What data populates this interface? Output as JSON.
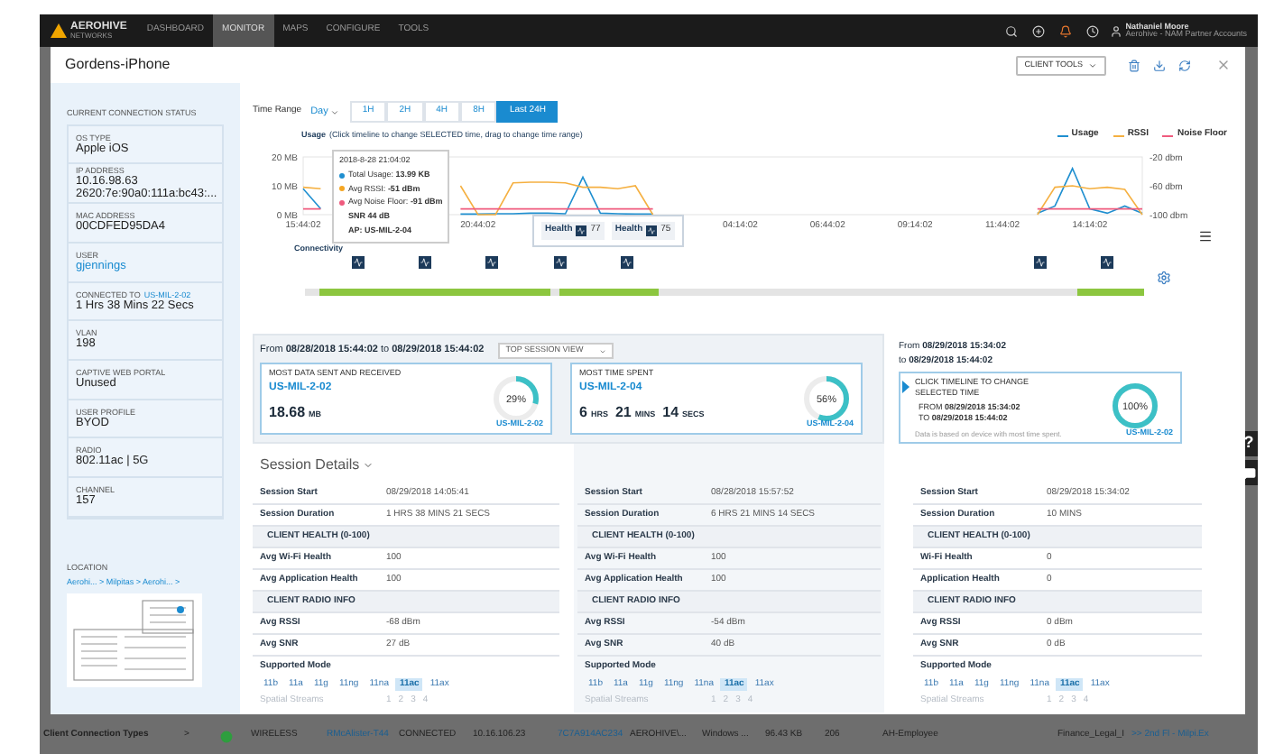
{
  "nav": {
    "logo": "AEROHIVE",
    "logo_sub": "NETWORKS",
    "items": [
      {
        "label": "DASHBOARD",
        "selected": false
      },
      {
        "label": "MONITOR",
        "selected": true
      },
      {
        "label": "MAPS",
        "selected": false
      },
      {
        "label": "CONFIGURE",
        "selected": false
      },
      {
        "label": "TOOLS",
        "selected": false
      }
    ],
    "user_name": "Nathaniel Moore",
    "user_account": "Aerohive - NAM Partner Accounts"
  },
  "page": {
    "side_label": "Client Connection Types",
    "side_chevron": ">",
    "row": [
      {
        "text": "WIRELESS",
        "link": false
      },
      {
        "text": "RMcAlister-T44",
        "link": true
      },
      {
        "text": "CONNECTED",
        "link": false
      },
      {
        "text": "10.16.106.23",
        "link": false
      },
      {
        "text": "7C7A914AC234",
        "link": true
      },
      {
        "text": "AEROHIVE\\...",
        "link": false
      },
      {
        "text": "Windows ...",
        "link": false
      },
      {
        "text": "96.43 KB",
        "link": false
      },
      {
        "text": "206",
        "link": false
      },
      {
        "text": "AH-Employee",
        "link": false
      },
      {
        "text": "Finance_Legal_I",
        "link": false
      },
      {
        "text": ">> 2nd Fl - Milpi.",
        "link": true
      },
      {
        "text": "Ex",
        "link": true
      }
    ],
    "help_button": "?"
  },
  "modal": {
    "title": "Gordens-iPhone",
    "tools_button": "CLIENT TOOLS"
  },
  "status": {
    "title": "CURRENT CONNECTION STATUS",
    "fields": [
      {
        "kind": "text",
        "label": "OS TYPE",
        "values": [
          "Apple iOS"
        ]
      },
      {
        "kind": "text",
        "label": "IP ADDRESS",
        "values": [
          "10.16.98.63",
          "2620:7e:90a0:111a:bc43:..."
        ]
      },
      {
        "kind": "text",
        "label": "MAC ADDRESS",
        "values": [
          "00CDFED95DA4"
        ]
      },
      {
        "kind": "link",
        "label": "USER",
        "values": [
          "gjennings"
        ]
      },
      {
        "kind": "label_link",
        "label": "CONNECTED TO",
        "label_link": "US-MIL-2-02",
        "values": [
          "1 Hrs 38 Mins 22 Secs"
        ]
      },
      {
        "kind": "text",
        "label": "VLAN",
        "values": [
          "198"
        ]
      },
      {
        "kind": "text",
        "label": "CAPTIVE WEB PORTAL",
        "values": [
          "Unused"
        ]
      },
      {
        "kind": "text",
        "label": "USER PROFILE",
        "values": [
          "BYOD"
        ]
      },
      {
        "kind": "text",
        "label": "RADIO",
        "values": [
          "802.11ac | 5G"
        ]
      },
      {
        "kind": "text",
        "label": "CHANNEL",
        "values": [
          "157"
        ]
      }
    ],
    "location": {
      "label": "LOCATION",
      "path": "Aerohi... > Milpitas > Aerohi... >"
    }
  },
  "time_range": {
    "label": "Time Range",
    "period": "Day",
    "buttons": [
      {
        "label": "1H",
        "selected": false
      },
      {
        "label": "2H",
        "selected": false
      },
      {
        "label": "4H",
        "selected": false
      },
      {
        "label": "8H",
        "selected": false
      },
      {
        "label": "Last 24H",
        "selected": true
      }
    ]
  },
  "usage_chart": {
    "title": "Usage",
    "hint": "(Click timeline to change SELECTED time, drag to change time range)",
    "chart_data": {
      "type": "line",
      "categories": [
        "15:44:02",
        null,
        null,
        null,
        null,
        null,
        null,
        null,
        null,
        null,
        "20:44:02",
        null,
        null,
        null,
        null,
        null,
        null,
        null,
        null,
        null,
        null,
        null,
        null,
        null,
        null,
        "04:14:02",
        null,
        null,
        null,
        null,
        "06:44:02",
        null,
        null,
        null,
        null,
        "09:14:02",
        null,
        null,
        null,
        null,
        "11:44:02",
        null,
        null,
        null,
        null,
        "14:14:02",
        null,
        null,
        null
      ],
      "series": [
        {
          "name": "Usage",
          "color": "#1f8fd0",
          "values": [
            9,
            2,
            null,
            null,
            null,
            null,
            null,
            null,
            null,
            0.2,
            0.2,
            0.3,
            0.3,
            0.5,
            0.5,
            0.3,
            13,
            0.5,
            0.3,
            0.2,
            0.2,
            null,
            null,
            null,
            null,
            null,
            null,
            null,
            null,
            null,
            null,
            null,
            null,
            null,
            null,
            null,
            null,
            null,
            null,
            null,
            null,
            null,
            0.5,
            3,
            16,
            2,
            0.5,
            3,
            0.5
          ]
        },
        {
          "name": "RSSI",
          "color": "#f5b041",
          "axis": "y2",
          "values": [
            -62,
            -64,
            null,
            null,
            null,
            null,
            null,
            null,
            null,
            -60,
            -100,
            -100,
            -56,
            -55,
            -55,
            -56,
            -62,
            -62,
            -64,
            -60,
            -100,
            null,
            null,
            null,
            null,
            null,
            null,
            null,
            null,
            null,
            null,
            null,
            null,
            null,
            null,
            null,
            null,
            null,
            null,
            null,
            null,
            null,
            -100,
            -62,
            -60,
            -64,
            -62,
            -65,
            -100
          ]
        },
        {
          "name": "Noise Floor",
          "color": "#ef5b7e",
          "axis": "y2",
          "values": [
            -92,
            -92,
            null,
            null,
            null,
            null,
            null,
            null,
            null,
            -92,
            -92,
            -92,
            -92,
            -92,
            -92,
            -92,
            -92,
            -92,
            -92,
            -92,
            -92,
            null,
            null,
            null,
            null,
            null,
            null,
            null,
            null,
            null,
            null,
            null,
            null,
            null,
            null,
            null,
            null,
            null,
            null,
            null,
            null,
            null,
            -92,
            -92,
            -92,
            -92,
            -92,
            -92,
            -92
          ]
        }
      ],
      "ylim": [
        0,
        20
      ],
      "y2lim": [
        -100,
        -20
      ],
      "yticks": [
        {
          "value": 20,
          "label": "20 MB"
        },
        {
          "value": 10,
          "label": "10 MB"
        },
        {
          "value": 0,
          "label": "0 MB"
        }
      ],
      "y2ticks": [
        {
          "value": -20,
          "label": "-20 dbm"
        },
        {
          "value": -60,
          "label": "-60 dbm"
        },
        {
          "value": -100,
          "label": "-100 dbm"
        }
      ]
    },
    "tooltip": {
      "time": "2018-8-28 21:04:02",
      "lines": [
        {
          "text": "Total Usage: **13.99 KB**",
          "color": "#1f8fd0"
        },
        {
          "text": "Avg RSSI: **-51 dBm**",
          "color": "#f5a623"
        },
        {
          "text": "Avg Noise Floor: **-91 dBm**",
          "color": "#ef5b7e"
        }
      ],
      "extra": [
        "SNR 44 dB",
        "AP: US-MIL-2-04"
      ]
    },
    "health_popup": [
      {
        "label": "Health",
        "value": "77"
      },
      {
        "label": "Health",
        "value": "75"
      }
    ]
  },
  "connectivity": {
    "label": "Connectivity"
  },
  "summary": {
    "range": "From **08/28/2018 15:44:02** to **08/29/2018 15:44:02**",
    "view_select": "TOP SESSION VIEW",
    "cards": [
      {
        "title": "MOST DATA SENT AND RECEIVED",
        "link": "US-MIL-2-02",
        "value": [
          {
            "num": "18.68",
            "unit": "MB"
          }
        ],
        "percent": "29%",
        "level": 0.29,
        "footer": "US-MIL-2-02"
      },
      {
        "title": "MOST TIME SPENT",
        "link": "US-MIL-2-04",
        "value": [
          {
            "num": "6",
            "unit": "HRS"
          },
          {
            "num": "21",
            "unit": "MINS"
          },
          {
            "num": "14",
            "unit": "SECS"
          }
        ],
        "percent": "56%",
        "level": 0.56,
        "footer": "US-MIL-2-04"
      }
    ]
  },
  "selected": {
    "range_from": "From **08/29/2018 15:34:02**",
    "range_to": "to **08/29/2018 15:44:02**",
    "card": {
      "title": "CLICK TIMELINE TO CHANGE SELECTED TIME",
      "from": "FROM **08/29/2018 15:34:02**",
      "to": "TO **08/29/2018 15:44:02**",
      "note": "Data is based on device with most time spent.",
      "percent": "100%",
      "level": 1,
      "footer": "US-MIL-2-02"
    }
  },
  "session_details": {
    "title": "Session Details",
    "columns": [
      {
        "rows": [
          {
            "kind": "row",
            "label": "Session Start",
            "value": "08/29/2018 14:05:41"
          },
          {
            "kind": "row",
            "label": "Session Duration",
            "value": "1 HRS 38 MINS 21 SECS"
          },
          {
            "kind": "section",
            "label": "CLIENT HEALTH (0-100)"
          },
          {
            "kind": "row",
            "label": "Avg Wi-Fi Health",
            "value": "100"
          },
          {
            "kind": "row",
            "label": "Avg Application Health",
            "value": "100"
          },
          {
            "kind": "section",
            "label": "CLIENT RADIO INFO"
          },
          {
            "kind": "row",
            "label": "Avg RSSI",
            "value": "-68 dBm"
          },
          {
            "kind": "row",
            "label": "Avg SNR",
            "value": "27 dB"
          },
          {
            "kind": "modes",
            "label": "Supported Mode",
            "modes": [
              {
                "label": "11b",
                "selected": false
              },
              {
                "label": "11a",
                "selected": false
              },
              {
                "label": "11g",
                "selected": false
              },
              {
                "label": "11ng",
                "selected": false
              },
              {
                "label": "11na",
                "selected": false
              },
              {
                "label": "11ac",
                "selected": true
              },
              {
                "label": "11ax",
                "selected": false
              }
            ]
          },
          {
            "kind": "streams",
            "label": "Spatial Streams",
            "values": [
              "1",
              "2",
              "3",
              "4"
            ]
          }
        ]
      },
      {
        "rows": [
          {
            "kind": "row",
            "label": "Session Start",
            "value": "08/28/2018 15:57:52"
          },
          {
            "kind": "row",
            "label": "Session Duration",
            "value": "6 HRS 21 MINS 14 SECS"
          },
          {
            "kind": "section",
            "label": "CLIENT HEALTH (0-100)"
          },
          {
            "kind": "row",
            "label": "Avg Wi-Fi Health",
            "value": "100"
          },
          {
            "kind": "row",
            "label": "Avg Application Health",
            "value": "100"
          },
          {
            "kind": "section",
            "label": "CLIENT RADIO INFO"
          },
          {
            "kind": "row",
            "label": "Avg RSSI",
            "value": "-54 dBm"
          },
          {
            "kind": "row",
            "label": "Avg SNR",
            "value": "40 dB"
          },
          {
            "kind": "modes",
            "label": "Supported Mode",
            "modes": [
              {
                "label": "11b",
                "selected": false
              },
              {
                "label": "11a",
                "selected": false
              },
              {
                "label": "11g",
                "selected": false
              },
              {
                "label": "11ng",
                "selected": false
              },
              {
                "label": "11na",
                "selected": false
              },
              {
                "label": "11ac",
                "selected": true
              },
              {
                "label": "11ax",
                "selected": false
              }
            ]
          },
          {
            "kind": "streams",
            "label": "Spatial Streams",
            "values": [
              "1",
              "2",
              "3",
              "4"
            ]
          }
        ]
      },
      {
        "rows": [
          {
            "kind": "row",
            "label": "Session Start",
            "value": "08/29/2018 15:34:02"
          },
          {
            "kind": "row",
            "label": "Session Duration",
            "value": "10 MINS"
          },
          {
            "kind": "section",
            "label": "CLIENT HEALTH (0-100)"
          },
          {
            "kind": "row",
            "label": "Wi-Fi Health",
            "value": "0"
          },
          {
            "kind": "row",
            "label": "Application Health",
            "value": "0"
          },
          {
            "kind": "section",
            "label": "CLIENT RADIO INFO"
          },
          {
            "kind": "row",
            "label": "Avg RSSI",
            "value": "0 dBm"
          },
          {
            "kind": "row",
            "label": "Avg SNR",
            "value": "0 dB"
          },
          {
            "kind": "modes",
            "label": "Supported Mode",
            "modes": [
              {
                "label": "11b",
                "selected": false
              },
              {
                "label": "11a",
                "selected": false
              },
              {
                "label": "11g",
                "selected": false
              },
              {
                "label": "11ng",
                "selected": false
              },
              {
                "label": "11na",
                "selected": false
              },
              {
                "label": "11ac",
                "selected": true
              },
              {
                "label": "11ax",
                "selected": false
              }
            ]
          },
          {
            "kind": "streams",
            "label": "Spatial Streams",
            "values": [
              "1",
              "2",
              "3",
              "4"
            ]
          }
        ]
      }
    ]
  }
}
